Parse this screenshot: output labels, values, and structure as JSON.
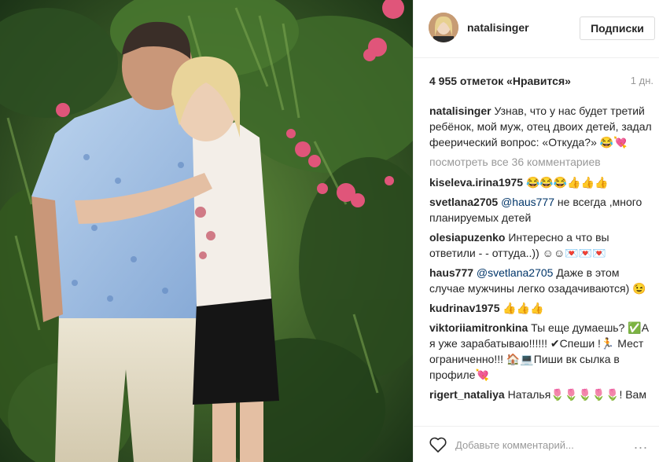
{
  "post": {
    "username": "natalisinger",
    "follow_label": "Подписки",
    "likes": "4 955 отметок «Нравится»",
    "time": "1 дн.",
    "caption_author": "natalisinger",
    "caption_text": " Узнав, что у нас будет третий ребёнок, мой муж, отец двоих детей, задал феерический вопрос: «Откуда?» 😂💘",
    "view_all": "посмотреть все 36 комментариев"
  },
  "comments": [
    {
      "author": "kiseleva.irina1975",
      "mention": "",
      "text": " 😂😂😂👍👍👍"
    },
    {
      "author": "svetlana2705",
      "mention": " @haus777",
      "text": " не всегда ,много планируемых детей"
    },
    {
      "author": "olesiapuzenko",
      "mention": "",
      "text": " Интересно а что вы ответили - - оттуда..)) ☺☺💌💌💌"
    },
    {
      "author": "haus777",
      "mention": " @svetlana2705",
      "text": " Даже в этом случае мужчины легко озадачиваются) 😉"
    },
    {
      "author": "kudrinav1975",
      "mention": "",
      "text": " 👍👍👍"
    },
    {
      "author": "viktoriiamitronkina",
      "mention": "",
      "text": " Ты еще думаешь? ✅А я уже зарабатываю!!!!!! ✔Спеши !🏃 Мест ограниченно!!! 🏠💻Пиши вк сылка в профиле💘"
    },
    {
      "author": "rigert_nataliya",
      "mention": "",
      "text": " Наталья🌷🌷🌷🌷🌷! Вам"
    }
  ],
  "add_comment": {
    "placeholder": "Добавьте комментарий...",
    "more": "..."
  },
  "icons": {
    "like": "heart-outline-icon",
    "options": "more-options-icon"
  }
}
